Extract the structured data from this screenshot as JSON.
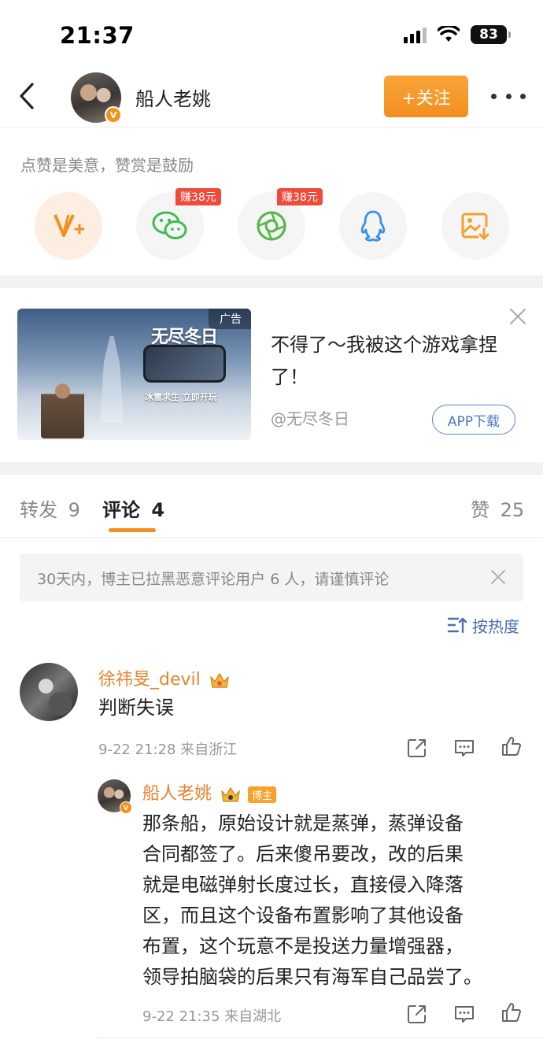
{
  "status_bar": {
    "time": "21:37",
    "battery": "83"
  },
  "header": {
    "author_name": "船人老姚",
    "follow_label": "+关注",
    "verified_mark": "V"
  },
  "reward": {
    "tip": "点赞是美意，赞赏是鼓励",
    "options": [
      {
        "icon": "v-plus-icon",
        "tag": ""
      },
      {
        "icon": "wechat-icon",
        "tag": "赚38元"
      },
      {
        "icon": "moments-icon",
        "tag": "赚38元"
      },
      {
        "icon": "qq-icon",
        "tag": ""
      },
      {
        "icon": "save-image-icon",
        "tag": ""
      }
    ]
  },
  "ad": {
    "label": "广告",
    "image_logo": "无尽冬日",
    "image_slogan": "冰雪求生 立即开玩",
    "title": "不得了～我被这个游戏拿捏了！",
    "source": "@无尽冬日",
    "download_label": "APP下载"
  },
  "tabs": {
    "repost": {
      "label": "转发",
      "count": "9"
    },
    "comment": {
      "label": "评论",
      "count": "4"
    },
    "like": {
      "label": "赞",
      "count": "25"
    }
  },
  "notice": {
    "text": "30天内，博主已拉黑恶意评论用户 6 人，请谨慎评论"
  },
  "sort": {
    "label": "按热度"
  },
  "comments": [
    {
      "user": "徐祎旻_devil",
      "text": "判断失误",
      "meta": "9-22 21:28  来自浙江"
    }
  ],
  "reply": {
    "user": "船人老姚",
    "owner_tag": "博主",
    "lines": [
      "那条船，原始设计就是蒸弹，蒸弹设备",
      "合同都签了。后来傻吊要改，改的后果",
      "就是电磁弹射长度过长，直接侵入降落",
      "区，而且这个设备布置影响了其他设备",
      "布置，这个玩意不是投送力量增强器，",
      "领导拍脑袋的后果只有海军自己品尝了。"
    ],
    "meta": "9-22 21:35  来自湖北"
  },
  "colors": {
    "accent": "#f28f1f",
    "link_blue": "#4a6fb0",
    "name_orange": "#e8832a"
  }
}
